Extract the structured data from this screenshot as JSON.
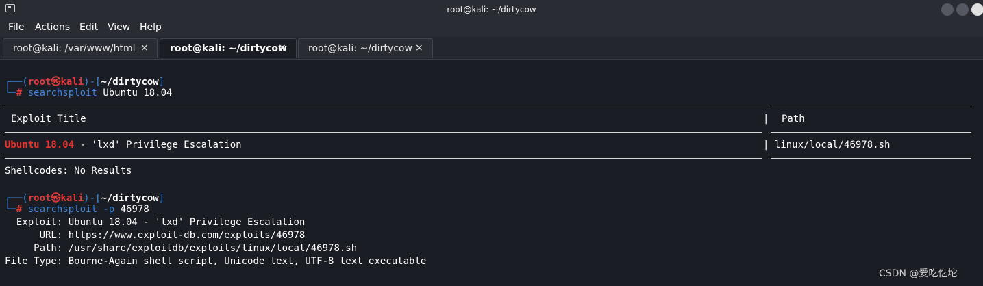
{
  "window": {
    "title": "root@kali: ~/dirtycow"
  },
  "menu": [
    "File",
    "Actions",
    "Edit",
    "View",
    "Help"
  ],
  "tabs": [
    {
      "label": "root@kali: /var/www/html",
      "close": "×"
    },
    {
      "label": "root@kali: ~/dirtycow",
      "close": "×"
    },
    {
      "label": "root@kali: ~/dirtycow",
      "close": "×"
    }
  ],
  "prompt": {
    "open_prefix": "┌──(",
    "user": "root",
    "skull": "㉿",
    "host": "kali",
    "mid": ")-[",
    "dir": "~/dirtycow",
    "close": "]",
    "cmd_prefix": "└─",
    "hash": "#"
  },
  "commands": [
    {
      "name": "searchsploit",
      "args": "Ubuntu 18.04"
    },
    {
      "name": "searchsploit",
      "flag": "-p",
      "args": "46978"
    }
  ],
  "results_table": {
    "col_title": "Exploit Title",
    "col_sep": "|",
    "col_path": "Path",
    "row_highlight": "Ubuntu 18.04",
    "row_rest": " - 'lxd' Privilege Escalation",
    "row_path": "linux/local/46978.sh"
  },
  "shellcodes": "Shellcodes: No Results",
  "details": [
    {
      "label": "  Exploit: ",
      "value": "Ubuntu 18.04 - 'lxd' Privilege Escalation"
    },
    {
      "label": "      URL: ",
      "value": "https://www.exploit-db.com/exploits/46978"
    },
    {
      "label": "     Path: ",
      "value": "/usr/share/exploitdb/exploits/linux/local/46978.sh"
    },
    {
      "label": "File Type: ",
      "value": "Bourne-Again shell script, Unicode text, UTF-8 text executable"
    }
  ],
  "watermark": "CSDN @爱吃仡坨"
}
